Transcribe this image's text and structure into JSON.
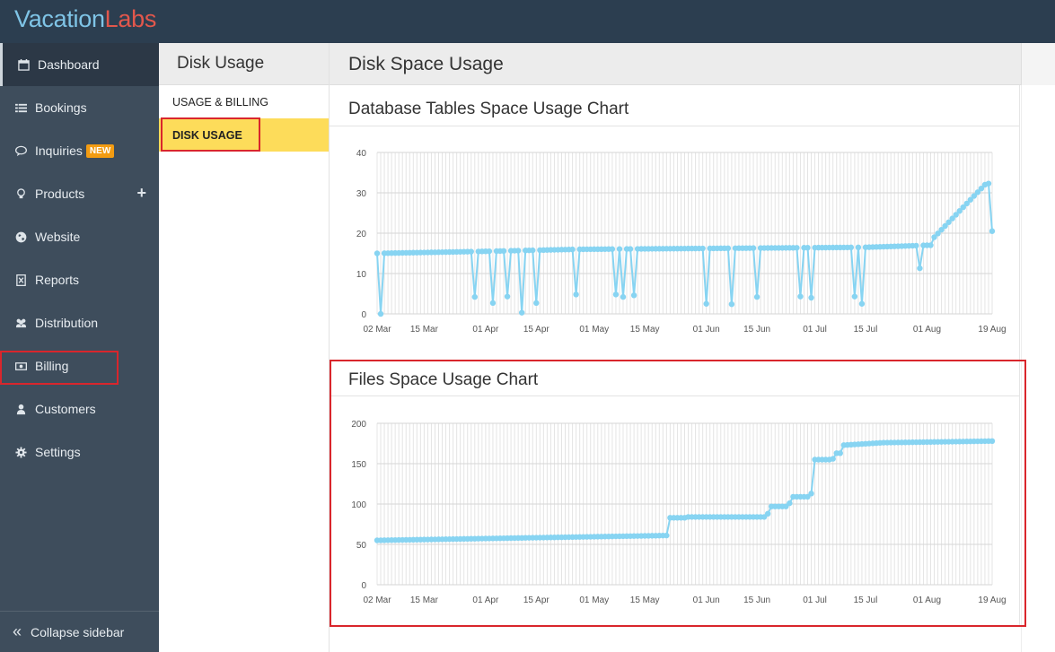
{
  "app": {
    "logo_part1": "Vacation",
    "logo_part2": "Labs"
  },
  "sidebar": {
    "items": [
      {
        "label": "Dashboard",
        "icon": "calendar-icon",
        "active": true
      },
      {
        "label": "Bookings",
        "icon": "list-icon"
      },
      {
        "label": "Inquiries",
        "icon": "chat-icon",
        "badge": "NEW"
      },
      {
        "label": "Products",
        "icon": "bulb-icon",
        "extra": "+"
      },
      {
        "label": "Website",
        "icon": "globe-icon"
      },
      {
        "label": "Reports",
        "icon": "report-icon"
      },
      {
        "label": "Distribution",
        "icon": "users-icon"
      },
      {
        "label": "Billing",
        "icon": "money-icon"
      },
      {
        "label": "Customers",
        "icon": "user-icon"
      },
      {
        "label": "Settings",
        "icon": "gear-icon"
      }
    ],
    "collapse_label": "Collapse sidebar"
  },
  "subnav": {
    "title": "Disk Usage",
    "items": [
      {
        "label": "USAGE & BILLING"
      },
      {
        "label": "DISK USAGE",
        "active": true
      }
    ]
  },
  "main": {
    "title": "Disk Space Usage"
  },
  "colors": {
    "line": "#87d4f2",
    "highlight": "#d9262c",
    "active_yellow": "#fddc5a"
  },
  "chart_data": [
    {
      "type": "line",
      "title": "Database Tables Space Usage Chart",
      "x_tick_labels": [
        "02 Mar",
        "15 Mar",
        "01 Apr",
        "15 Apr",
        "01 May",
        "15 May",
        "01 Jun",
        "15 Jun",
        "01 Jul",
        "15 Jul",
        "01 Aug",
        "19 Aug"
      ],
      "x_range": [
        "2016-03-02",
        "2016-08-19"
      ],
      "ylim": [
        0,
        40
      ],
      "y_ticks": [
        0,
        10,
        20,
        30,
        40
      ],
      "grid": true,
      "baseline": [
        [
          0,
          15.0
        ],
        [
          30,
          15.5
        ],
        [
          55,
          16.0
        ],
        [
          110,
          16.3
        ],
        [
          135,
          16.7
        ],
        [
          152,
          17.0
        ],
        [
          156,
          19.0
        ],
        [
          175,
          24.0
        ],
        [
          200,
          31.0
        ],
        [
          170,
          23.0
        ],
        [
          188,
          28.5
        ]
      ],
      "dips": [
        [
          1,
          0
        ],
        [
          30,
          4.2
        ],
        [
          37,
          2.7
        ],
        [
          41,
          4.3
        ],
        [
          46,
          0.3
        ],
        [
          50,
          2.7
        ],
        [
          60,
          4.8
        ],
        [
          72,
          4.8
        ],
        [
          74,
          4.2
        ],
        [
          77,
          4.6
        ],
        [
          97,
          2.5
        ],
        [
          105,
          2.4
        ],
        [
          113,
          4.2
        ],
        [
          125,
          4.3
        ],
        [
          128,
          4.0
        ],
        [
          141,
          4.3
        ],
        [
          143,
          2.5
        ],
        [
          172,
          11.3
        ],
        [
          203,
          20.5
        ]
      ],
      "x_days_start": 0,
      "x_days_end": 170
    },
    {
      "type": "line",
      "title": "Files Space Usage Chart",
      "x_tick_labels": [
        "02 Mar",
        "15 Mar",
        "01 Apr",
        "15 Apr",
        "01 May",
        "15 May",
        "01 Jun",
        "15 Jun",
        "01 Jul",
        "15 Jul",
        "01 Aug",
        "19 Aug"
      ],
      "x_range": [
        "2016-03-02",
        "2016-08-19"
      ],
      "ylim": [
        0,
        200
      ],
      "y_ticks": [
        0,
        50,
        100,
        150,
        200
      ],
      "grid": true,
      "steps": [
        [
          0,
          55
        ],
        [
          80,
          61
        ],
        [
          81,
          83
        ],
        [
          86,
          84
        ],
        [
          107,
          84
        ],
        [
          108,
          88
        ],
        [
          109,
          97
        ],
        [
          114,
          101
        ],
        [
          115,
          109
        ],
        [
          119,
          109
        ],
        [
          120,
          113
        ],
        [
          121,
          155
        ],
        [
          126,
          156
        ],
        [
          127,
          163
        ],
        [
          129,
          173
        ],
        [
          140,
          176
        ],
        [
          170,
          178
        ]
      ]
    }
  ]
}
